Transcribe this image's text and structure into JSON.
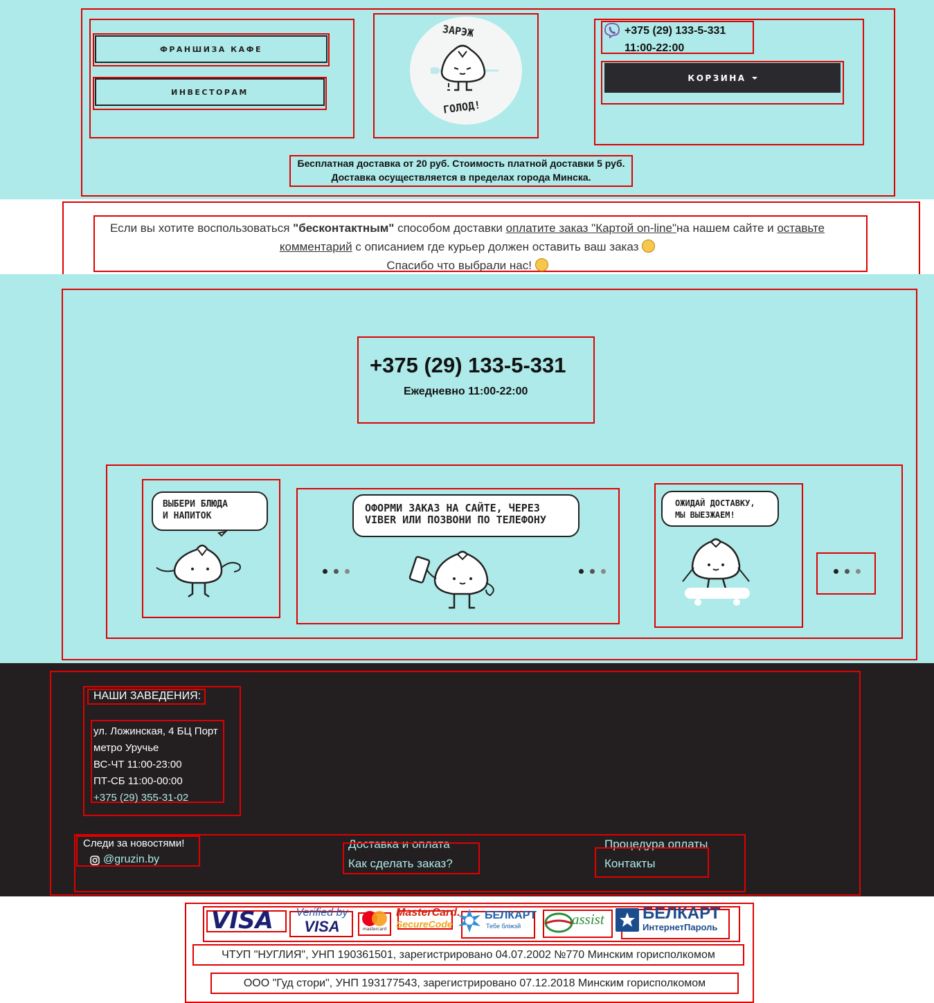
{
  "header": {
    "franchise_label": "ФРАНШИЗА КАФЕ",
    "investors_label": "ИНВЕСТОРАМ",
    "logo_top": "ЗАРЭЖ",
    "logo_bottom": "ГОЛОД!",
    "phone": "+375 (29) 133-5-331",
    "hours": "11:00-22:00",
    "cart_label": "КОРЗИНА",
    "delivery_line1": "Бесплатная доставка от 20 руб. Стоимость платной доставки 5 руб.",
    "delivery_line2": "Доставка осуществляется в пределах города Минска."
  },
  "notice": {
    "t1": "Если вы хотите воспользоваться ",
    "t2": "\"бесконтактным\"",
    "t3": " способом доставки ",
    "link1": "оплатите заказ \"Картой on-line\"",
    "t4": "на нашем сайте и ",
    "link2a": "оставьте",
    "link2b": "комментарий",
    "t5": " с описанием где курьер должен оставить ваш заказ ",
    "t6": "Спасибо что выбрали нас! "
  },
  "contact": {
    "phone": "+375 (29) 133-5-331",
    "daily": "Ежедневно 11:00-22:00"
  },
  "steps": [
    {
      "line1": "ВЫБЕРИ БЛЮДА",
      "line2": "И НАПИТОК"
    },
    {
      "line1": "ОФОРМИ ЗАКАЗ НА САЙТЕ, ЧЕРЕЗ",
      "line2": "VIBER ИЛИ ПОЗВОНИ ПО ТЕЛЕФОНУ"
    },
    {
      "line1": "ОЖИДАЙ ДОСТАВКУ,",
      "line2": "МЫ ВЫЕЗЖАЕМ!"
    }
  ],
  "footer": {
    "places_title": "НАШИ ЗАВЕДЕНИЯ:",
    "address1": "ул. Ложинская, 4 БЦ Порт",
    "address2": "метро Уручье",
    "hours1": "ВС-ЧТ 11:00-23:00",
    "hours2": "ПТ-СБ 11:00-00:00",
    "place_phone": "+375 (29) 355-31-02",
    "news_title": "Следи за новостями!",
    "instagram": "@gruzin.by",
    "link_delivery": "Доставка и оплата",
    "link_how": "Как сделать заказ?",
    "link_payment": "Процедура оплаты",
    "link_contacts": "Контакты"
  },
  "payments": {
    "visa": "VISA",
    "verified_top": "Verified by",
    "verified_bottom": "VISA",
    "mastercard_small": "mastercard",
    "securecode_top": "MasterCard.",
    "securecode_bottom": "SecureCode",
    "belkart": "БЕЛКАРТ",
    "belkart_sub": "Тебе бліжэй",
    "assist": "assist",
    "belkart2": "БЕЛКАРТ",
    "belkart2_sub": "ИнтернетПароль"
  },
  "legal": {
    "line1": "ЧТУП \"НУГЛИЯ\", УНП 190361501, зарегистрировано 04.07.2002 №770 Минским горисполкомом",
    "line2": "ООО \"Гуд стори\", УНП 193177543, зарегистрировано 07.12.2018 Минским горисполкомом"
  }
}
